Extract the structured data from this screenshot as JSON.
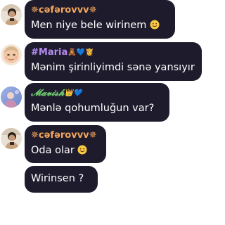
{
  "messages": [
    {
      "sender": "✵cəfərovvv✵",
      "sender_color": "#f2a65a",
      "text": "Men niye bele wirinem",
      "emoji": "smiling-face-icon"
    },
    {
      "sender": "#Maria",
      "sender_suffix": "🧸💙👸",
      "sender_color": "#b48cf0",
      "text": "Mənim şirinliyimdi sənə yansıyır"
    },
    {
      "sender": "𝓜𝓪𝓿𝓲𝓼𝓱",
      "sender_suffix": "👑💙",
      "sender_color": "#6cc46c",
      "text": "Mənlə qohumluğun var?"
    },
    {
      "sender": "✵cəfərovvv✵",
      "sender_color": "#f2a65a",
      "text": "Oda olar",
      "emoji": "smiling-face-icon"
    },
    {
      "text": "Wirinsen ?"
    }
  ]
}
